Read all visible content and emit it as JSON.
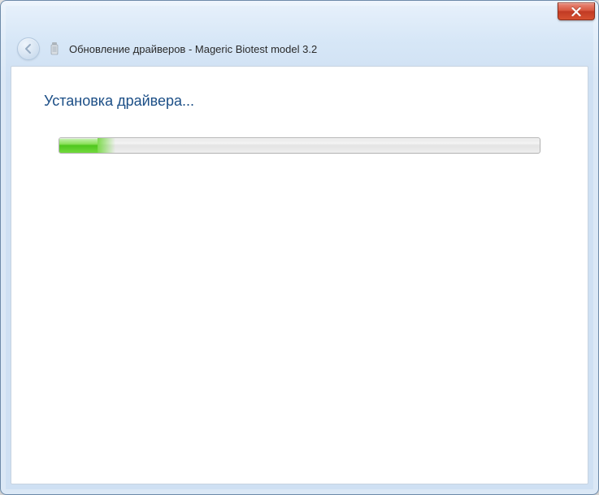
{
  "window": {
    "title": "Обновление драйверов - Mageric Biotest model 3.2"
  },
  "content": {
    "heading": "Установка драйвера...",
    "progress_percent": 8
  }
}
